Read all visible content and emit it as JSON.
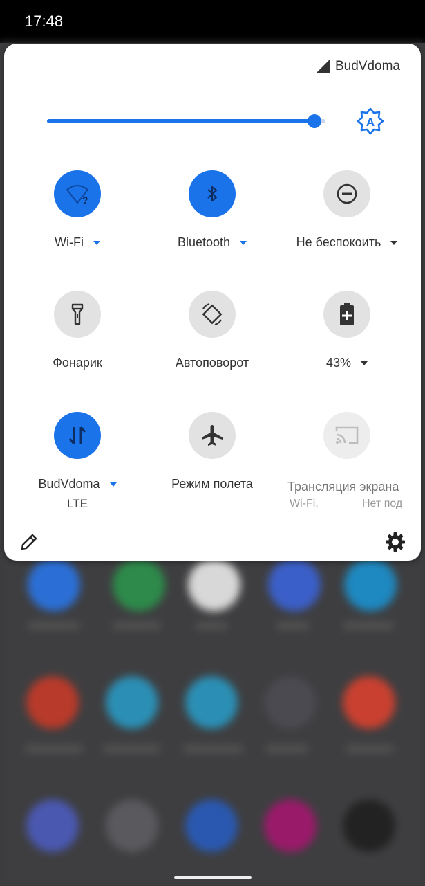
{
  "status_bar": {
    "time": "17:48"
  },
  "panel": {
    "carrier": "BudVdoma",
    "brightness": {
      "level": 0.96,
      "auto_icon": "auto-brightness-icon"
    },
    "tiles": [
      {
        "id": "wifi",
        "label": "Wi-Fi",
        "state": "on",
        "icon": "wifi-question-icon",
        "has_menu": true
      },
      {
        "id": "bluetooth",
        "label": "Bluetooth",
        "state": "on",
        "icon": "bluetooth-icon",
        "has_menu": true
      },
      {
        "id": "dnd",
        "label": "Не беспокоить",
        "state": "off",
        "icon": "do-not-disturb-icon",
        "has_menu": true
      },
      {
        "id": "flashlight",
        "label": "Фонарик",
        "state": "off",
        "icon": "flashlight-icon"
      },
      {
        "id": "autorotate",
        "label": "Автоповорот",
        "state": "off",
        "icon": "auto-rotate-icon"
      },
      {
        "id": "battery",
        "label": "43%",
        "state": "off",
        "icon": "battery-saver-icon",
        "has_menu": true
      },
      {
        "id": "mobile_data",
        "label": "BudVdoma",
        "sublabel": "LTE",
        "state": "on",
        "icon": "mobile-data-icon",
        "has_menu": true
      },
      {
        "id": "airplane",
        "label": "Режим полета",
        "state": "off",
        "icon": "airplane-icon"
      },
      {
        "id": "cast",
        "label": "Трансляция экрана",
        "sub_left": "Wi-Fi.",
        "sub_right": "Нет под",
        "state": "disabled",
        "icon": "cast-icon"
      }
    ]
  },
  "colors": {
    "accent": "#1a73e8",
    "tile_off": "#e2e2e2"
  }
}
